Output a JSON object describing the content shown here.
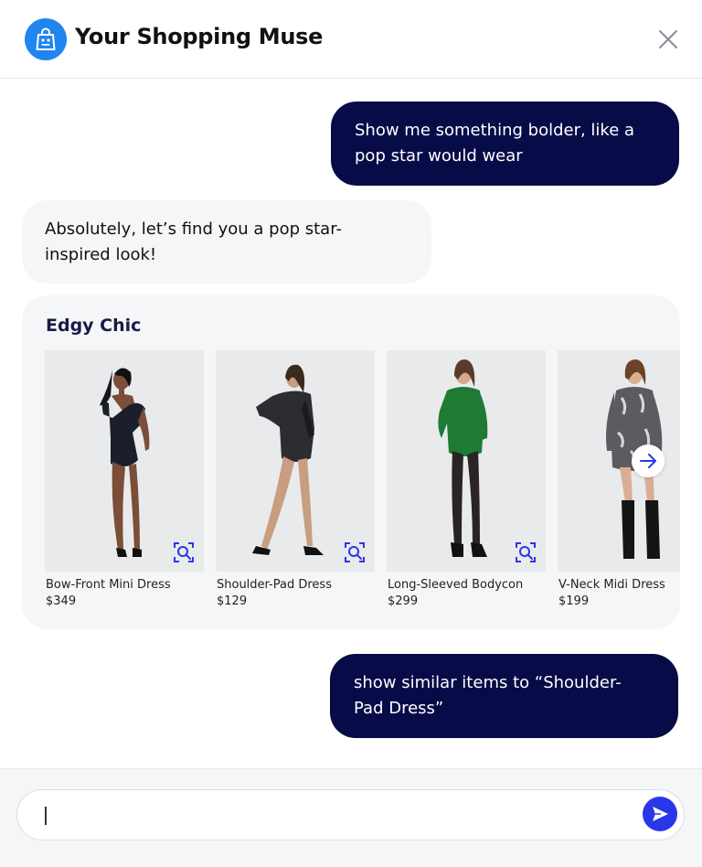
{
  "header": {
    "title": "Your Shopping Muse",
    "logo_icon": "shopping-bag-icon",
    "close_icon": "close-icon"
  },
  "messages": {
    "user_1": {
      "line1": "Show me something bolder, like a",
      "line2": "pop star would wear"
    },
    "bot_1": {
      "line1": "Absolutely, let’s find you a pop star-",
      "line2": "inspired look!"
    },
    "user_2": {
      "line1": "show similar items to “Shoulder-",
      "line2": "Pad Dress”"
    }
  },
  "carousel": {
    "title": "Edgy Chic",
    "products": [
      {
        "name": "Bow-Front Mini Dress",
        "price": "$349",
        "dress_color": "#1c1f2b"
      },
      {
        "name": "Shoulder-Pad Dress",
        "price": "$129",
        "dress_color": "#2b2d30"
      },
      {
        "name": "Long-Sleeved Bodycon",
        "price": "$299",
        "dress_color": "#1f7a34"
      },
      {
        "name": "V-Neck Midi Dress",
        "price": "$199",
        "dress_color": "#5c5c60"
      }
    ],
    "next_icon": "arrow-right-icon",
    "visual_search_icon": "visual-search-icon"
  },
  "composer": {
    "value": "",
    "placeholder": "",
    "send_icon": "send-icon"
  },
  "colors": {
    "user_bubble": "#070b47",
    "bot_bubble": "#f5f6f8",
    "accent": "#2a37e8",
    "logo": "#1f86ef"
  }
}
